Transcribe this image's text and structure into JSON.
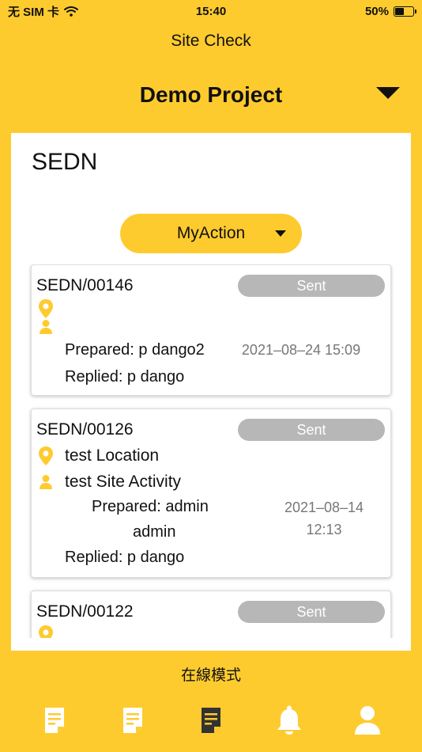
{
  "status_bar": {
    "carrier": "无 SIM 卡",
    "time": "15:40",
    "battery": "50%",
    "battery_level": 0.5
  },
  "app": {
    "title": "Site Check",
    "project": "Demo Project"
  },
  "panel": {
    "title": "SEDN",
    "filter_label": "MyAction"
  },
  "records": [
    {
      "id": "SEDN/00146",
      "status": "Sent",
      "location": "",
      "activity": "",
      "prepared_line1": "Prepared: p dango2",
      "prepared_line2": "",
      "date_line1": "2021–08–24 15:09",
      "date_line2": "",
      "replied": "Replied: p dango"
    },
    {
      "id": "SEDN/00126",
      "status": "Sent",
      "location": "test Location",
      "activity": "test Site Activity",
      "prepared_line1": "Prepared: admin",
      "prepared_line2": "admin",
      "date_line1": "2021–08–14",
      "date_line2": "12:13",
      "replied": "Replied: p dango"
    },
    {
      "id": "SEDN/00122",
      "status": "Sent",
      "location": "",
      "activity": ""
    }
  ],
  "footer": {
    "mode": "在線模式"
  },
  "tabs": [
    {
      "icon": "document-icon",
      "active": false
    },
    {
      "icon": "document-list-icon",
      "active": false
    },
    {
      "icon": "document-dark-icon",
      "active": true
    },
    {
      "icon": "bell-icon",
      "active": false
    },
    {
      "icon": "user-icon",
      "active": false
    }
  ],
  "colors": {
    "background": "#FECB2F",
    "badge": "#B7B7B7",
    "icon_light": "#FFFFFF",
    "icon_active": "#333333"
  }
}
